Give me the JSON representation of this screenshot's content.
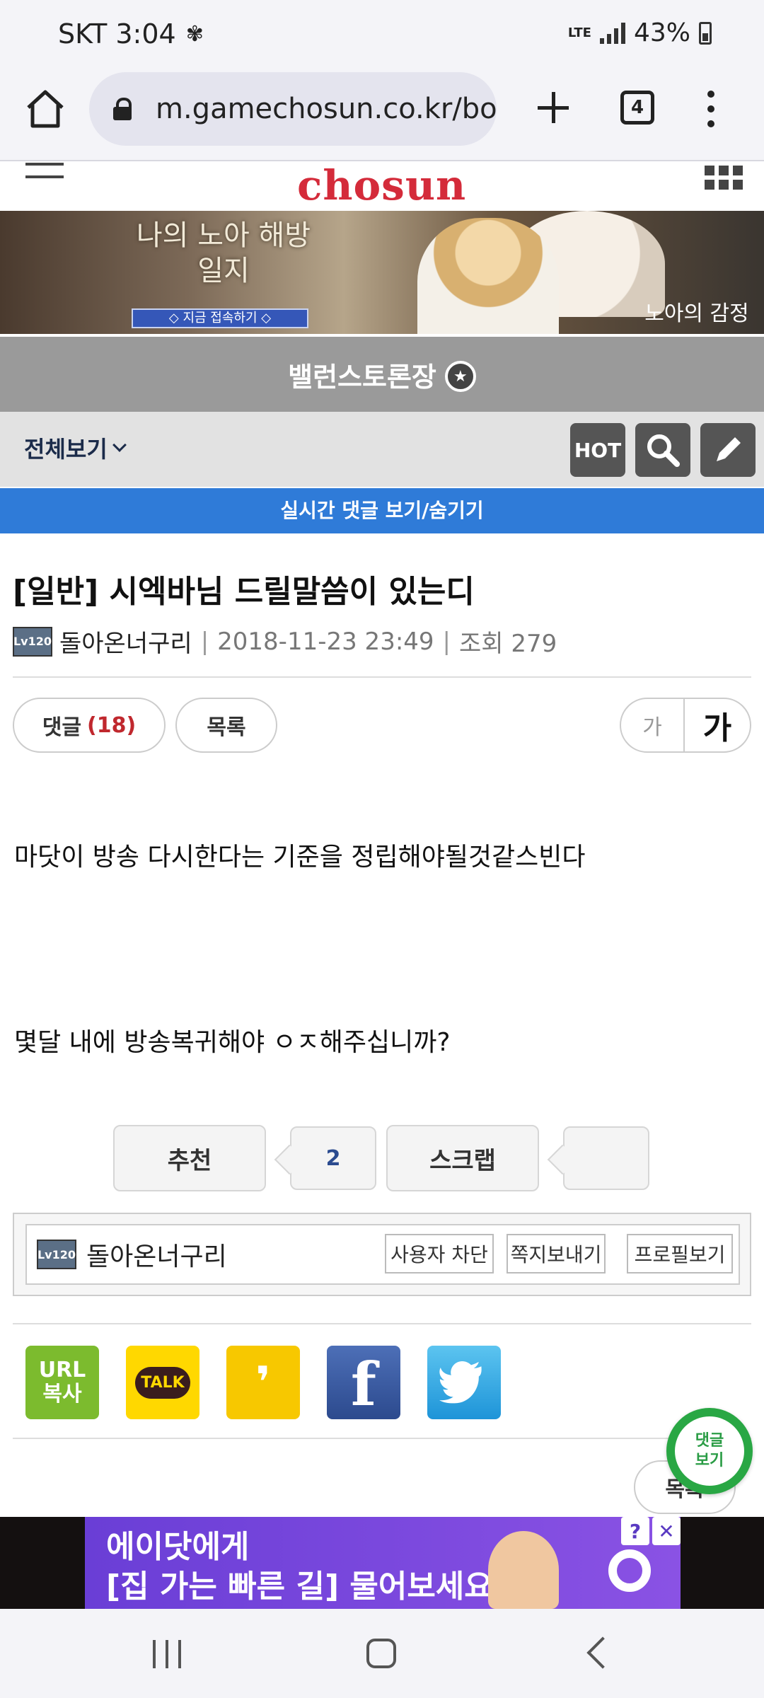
{
  "status_bar": {
    "carrier_time": "SKT 3:04",
    "network": "LTE",
    "battery": "43%"
  },
  "browser": {
    "url": "m.gamechosun.co.kr/bo",
    "tab_count": "4"
  },
  "site": {
    "logo": "chosun"
  },
  "banner": {
    "title": "나의 노아 해방일지",
    "cta": "◇ 지금 접속하기 ◇",
    "game_logo": "노아의 감정"
  },
  "board": {
    "title": "밸런스토론장",
    "view_all": "전체보기",
    "hot": "HOT",
    "comment_toggle": "실시간 댓글 보기/숨기기"
  },
  "post": {
    "title": "[일반] 시엑바님 드릴말씀이 있는디",
    "level_badge": "Lv120",
    "author": "돌아온너구리",
    "date": "2018-11-23 23:49",
    "views": "조회 279",
    "comments_label": "댓글",
    "comments_count": "(18)",
    "list_label": "목록",
    "font_small": "가",
    "font_large": "가",
    "body_line1": "마닷이 방송 다시한다는 기준을 정립해야될것같스빈다",
    "body_line2": "몇달 내에 방송복귀해야 ㅇㅈ해주십니까?"
  },
  "vote": {
    "recommend_label": "추천",
    "recommend_count": "2",
    "scrap_label": "스크랩",
    "scrap_count": ""
  },
  "author_box": {
    "name": "돌아온너구리",
    "block": "사용자 차단",
    "message": "쪽지보내기",
    "profile": "프로필보기"
  },
  "share": {
    "url_line1": "URL",
    "url_line2": "복사",
    "kakao_talk": "TALK",
    "kakao_story": "❜",
    "facebook": "f"
  },
  "fab": {
    "label_line1": "댓글",
    "label_line2": "보기"
  },
  "bottom_list": "목록",
  "ad": {
    "line1": "에이닷에게",
    "line2": "[집 가는 빠른 길] 물어보세요",
    "info": "?",
    "close": "✕"
  },
  "colors": {
    "brand_red": "#d42b3a",
    "toggle_blue": "#2f7bd8",
    "fab_green": "#29a744"
  }
}
